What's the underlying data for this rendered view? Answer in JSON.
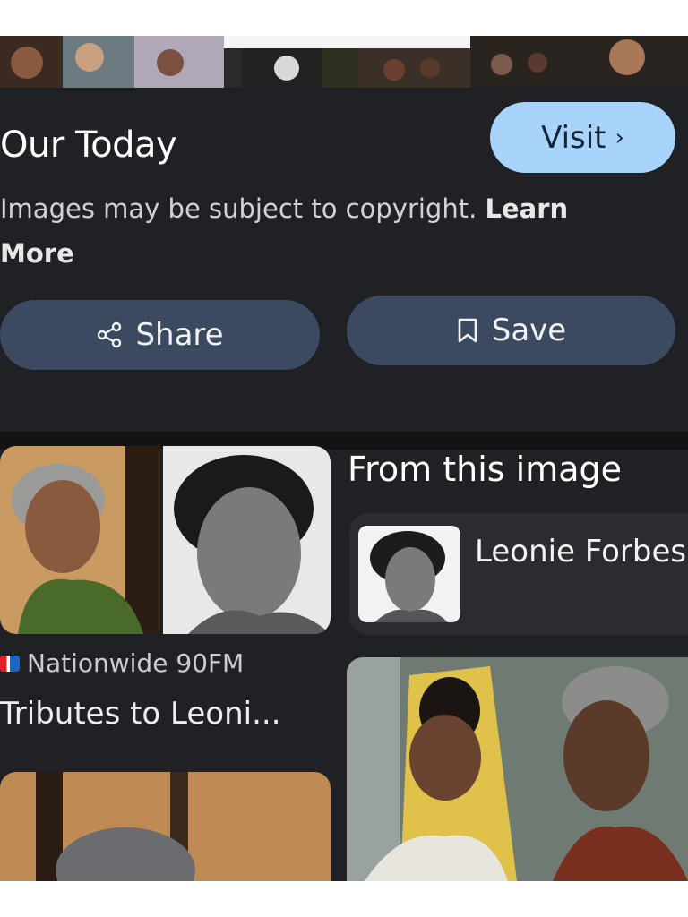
{
  "header": {
    "source_title": "Our Today",
    "visit_label": "Visit",
    "copyright_text": "Images may be subject to copyright.",
    "learn_more": "Learn More"
  },
  "actions": {
    "share_label": "Share",
    "save_label": "Save"
  },
  "results": {
    "first": {
      "source": "Nationwide 90FM",
      "caption": "Tributes to Leoni..."
    },
    "from_image": {
      "heading": "From this image",
      "entity": "Leonie Forbes"
    }
  },
  "colors": {
    "background": "#202124",
    "visit_button": "#a8d4fc",
    "action_button": "#3b4a61"
  },
  "icons": [
    "share-icon",
    "bookmark-icon",
    "chevron-right-icon"
  ]
}
